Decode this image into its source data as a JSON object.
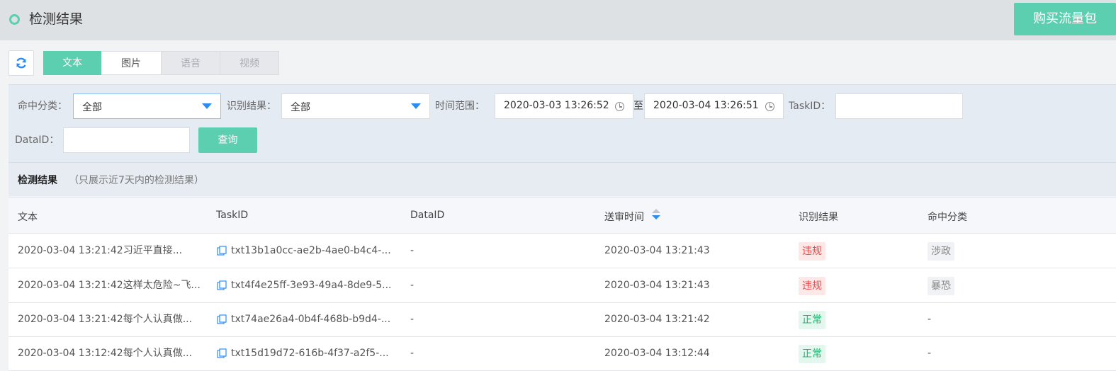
{
  "header": {
    "title": "检测结果",
    "buy_button": "购买流量包"
  },
  "tabs": [
    {
      "label": "文本",
      "state": "active"
    },
    {
      "label": "图片",
      "state": "normal"
    },
    {
      "label": "语音",
      "state": "disabled"
    },
    {
      "label": "视频",
      "state": "disabled"
    }
  ],
  "filters": {
    "hit_category": {
      "label": "命中分类：",
      "value": "全部"
    },
    "result": {
      "label": "识别结果：",
      "value": "全部"
    },
    "time_range": {
      "label": "时间范围：",
      "start": "2020-03-03 13:26:52",
      "separator": "至",
      "end": "2020-03-04 13:26:51"
    },
    "task_id": {
      "label": "TaskID：",
      "value": ""
    },
    "data_id": {
      "label": "DataID：",
      "value": ""
    },
    "query_button": "查询"
  },
  "results": {
    "title": "检测结果",
    "note": "（只展示近7天内的检测结果）",
    "columns": [
      "文本",
      "TaskID",
      "DataID",
      "送审时间",
      "识别结果",
      "命中分类"
    ],
    "rows": [
      {
        "text": "2020-03-04 13:21:42习近平直接...",
        "task_id": "txt13b1a0cc-ae2b-4ae0-b4c4-...",
        "data_id": "-",
        "time": "2020-03-04 13:21:43",
        "result": "违规",
        "result_type": "bad",
        "category": "涉政"
      },
      {
        "text": "2020-03-04 13:21:42这样太危险~飞...",
        "task_id": "txt4f4e25ff-3e93-49a4-8de9-5...",
        "data_id": "-",
        "time": "2020-03-04 13:21:43",
        "result": "违规",
        "result_type": "bad",
        "category": "暴恐"
      },
      {
        "text": "2020-03-04 13:21:42每个人认真做...",
        "task_id": "txt74ae26a4-0b4f-468b-b9d4-...",
        "data_id": "-",
        "time": "2020-03-04 13:21:42",
        "result": "正常",
        "result_type": "good",
        "category": "-"
      },
      {
        "text": "2020-03-04 13:12:42每个人认真做...",
        "task_id": "txt15d19d72-616b-4f37-a2f5-...",
        "data_id": "-",
        "time": "2020-03-04 13:12:44",
        "result": "正常",
        "result_type": "good",
        "category": "-"
      }
    ]
  },
  "colors": {
    "accent": "#5ccfb0",
    "link": "#2d8cf0",
    "danger": "#e84a4a",
    "success": "#27b36f"
  },
  "icons": {
    "refresh": "refresh-icon",
    "copy": "copy-icon",
    "clock": "clock-icon",
    "dropdown": "caret-down-icon",
    "sort": "sort-icon"
  }
}
